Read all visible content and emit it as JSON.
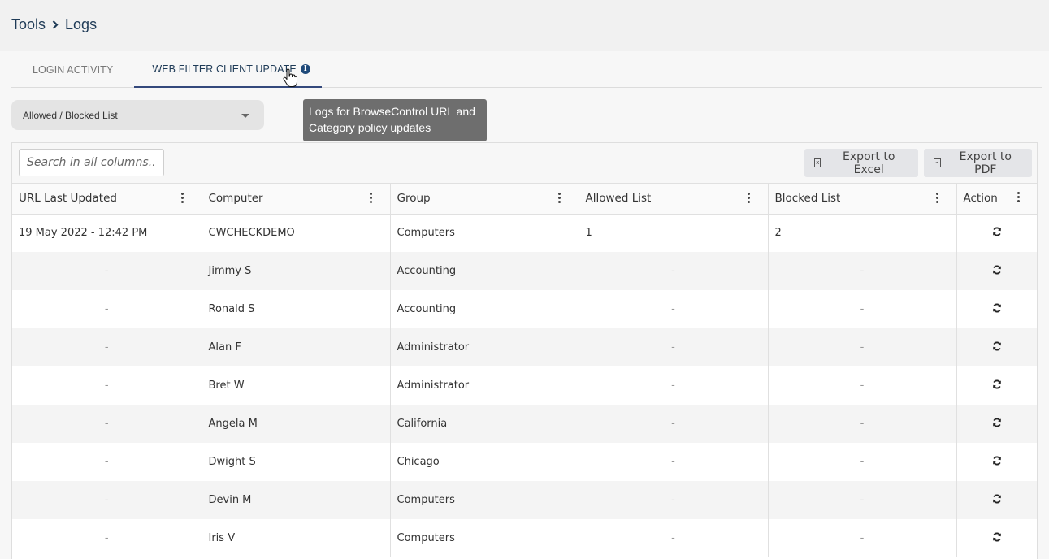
{
  "breadcrumb": {
    "parent": "Tools",
    "current": "Logs"
  },
  "tabs": [
    {
      "label": "LOGIN ACTIVITY",
      "active": false
    },
    {
      "label": "WEB FILTER CLIENT UPDATE",
      "active": true
    }
  ],
  "tooltip": {
    "text": "Logs for BrowseControl URL and Category policy updates"
  },
  "list_select": {
    "selected": "Allowed / Blocked List"
  },
  "toolbar": {
    "search_placeholder": "Search in all columns...",
    "export_excel": "Export to Excel",
    "export_pdf": "Export to PDF"
  },
  "table": {
    "columns": [
      "URL Last Updated",
      "Computer",
      "Group",
      "Allowed List",
      "Blocked List",
      "Action"
    ],
    "rows": [
      {
        "url_last_updated": "19 May 2022 - 12:42 PM",
        "computer": "CWCHECKDEMO",
        "group": "Computers",
        "allowed": "1",
        "blocked": "2",
        "action": "refresh-icon"
      },
      {
        "url_last_updated": "-",
        "computer": "Jimmy S",
        "group": "Accounting",
        "allowed": "-",
        "blocked": "-",
        "action": "refresh-icon"
      },
      {
        "url_last_updated": "-",
        "computer": "Ronald S",
        "group": "Accounting",
        "allowed": "-",
        "blocked": "-",
        "action": "refresh-icon"
      },
      {
        "url_last_updated": "-",
        "computer": "Alan F",
        "group": "Administrator",
        "allowed": "-",
        "blocked": "-",
        "action": "refresh-icon"
      },
      {
        "url_last_updated": "-",
        "computer": "Bret W",
        "group": "Administrator",
        "allowed": "-",
        "blocked": "-",
        "action": "refresh-icon"
      },
      {
        "url_last_updated": "-",
        "computer": "Angela M",
        "group": "California",
        "allowed": "-",
        "blocked": "-",
        "action": "refresh-icon"
      },
      {
        "url_last_updated": "-",
        "computer": "Dwight S",
        "group": "Chicago",
        "allowed": "-",
        "blocked": "-",
        "action": "refresh-icon"
      },
      {
        "url_last_updated": "-",
        "computer": "Devin M",
        "group": "Computers",
        "allowed": "-",
        "blocked": "-",
        "action": "refresh-icon"
      },
      {
        "url_last_updated": "-",
        "computer": "Iris V",
        "group": "Computers",
        "allowed": "-",
        "blocked": "-",
        "action": "refresh-icon"
      }
    ]
  },
  "colors": {
    "brand_dark": "#1f3b57",
    "active_tab_underline": "#34497c",
    "tooltip_bg": "#6e6e6e"
  }
}
